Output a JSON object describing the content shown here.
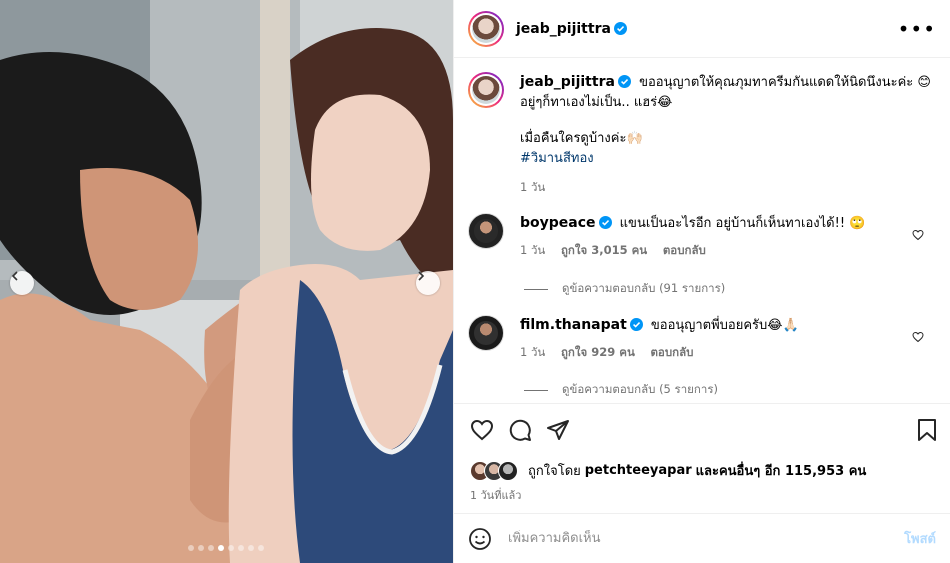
{
  "post": {
    "username": "jeab_pijittra",
    "caption_line1": "ขออนุญาตให้คุณภุมทาครีมกันแดดให้นิดนึงนะค่ะ 😊",
    "caption_line2": "อยู่ๆก็ทาเองไม่เป็น.. แฮร่😂",
    "caption_line3": "เมื่อคืนใครดูบ้างค่ะ🙌🏻",
    "hashtag": "#วิมานสีทอง",
    "caption_time": "1 วัน"
  },
  "comments": [
    {
      "username": "boypeace",
      "text": "แขนเป็นอะไรอีก อยู่บ้านก็เห็นทาเองได้!! 🙄",
      "time": "1 วัน",
      "likes": "ถูกใจ 3,015 คน",
      "reply": "ตอบกลับ",
      "view_replies": "ดูข้อความตอบกลับ (91 รายการ)"
    },
    {
      "username": "film.thanapat",
      "text": "ขออนุญาตพี่บอยครับ😂🙏🏻",
      "time": "1 วัน",
      "likes": "ถูกใจ 929 คน",
      "reply": "ตอบกลับ",
      "view_replies": "ดูข้อความตอบกลับ (5 รายการ)"
    }
  ],
  "likes_summary": {
    "prefix": "ถูกใจโดย",
    "liker": "petchteeyapar",
    "suffix": "และคนอื่นๆ อีก 115,953 คน"
  },
  "posted_time": "1 วันที่แล้ว",
  "composer": {
    "placeholder": "เพิ่มความคิดเห็น",
    "post_label": "โพสต์"
  },
  "carousel": {
    "slide_count": 8,
    "active_index": 3
  },
  "colors": {
    "verified": "#0095f6",
    "muted": "#737373",
    "hashtag": "#00376b",
    "post_disabled": "#b3dbff"
  },
  "icons": [
    "more-icon",
    "verified-icon",
    "heart-icon",
    "comment-icon",
    "share-icon",
    "bookmark-icon",
    "emoji-icon",
    "chevron-left-icon",
    "chevron-right-icon"
  ]
}
